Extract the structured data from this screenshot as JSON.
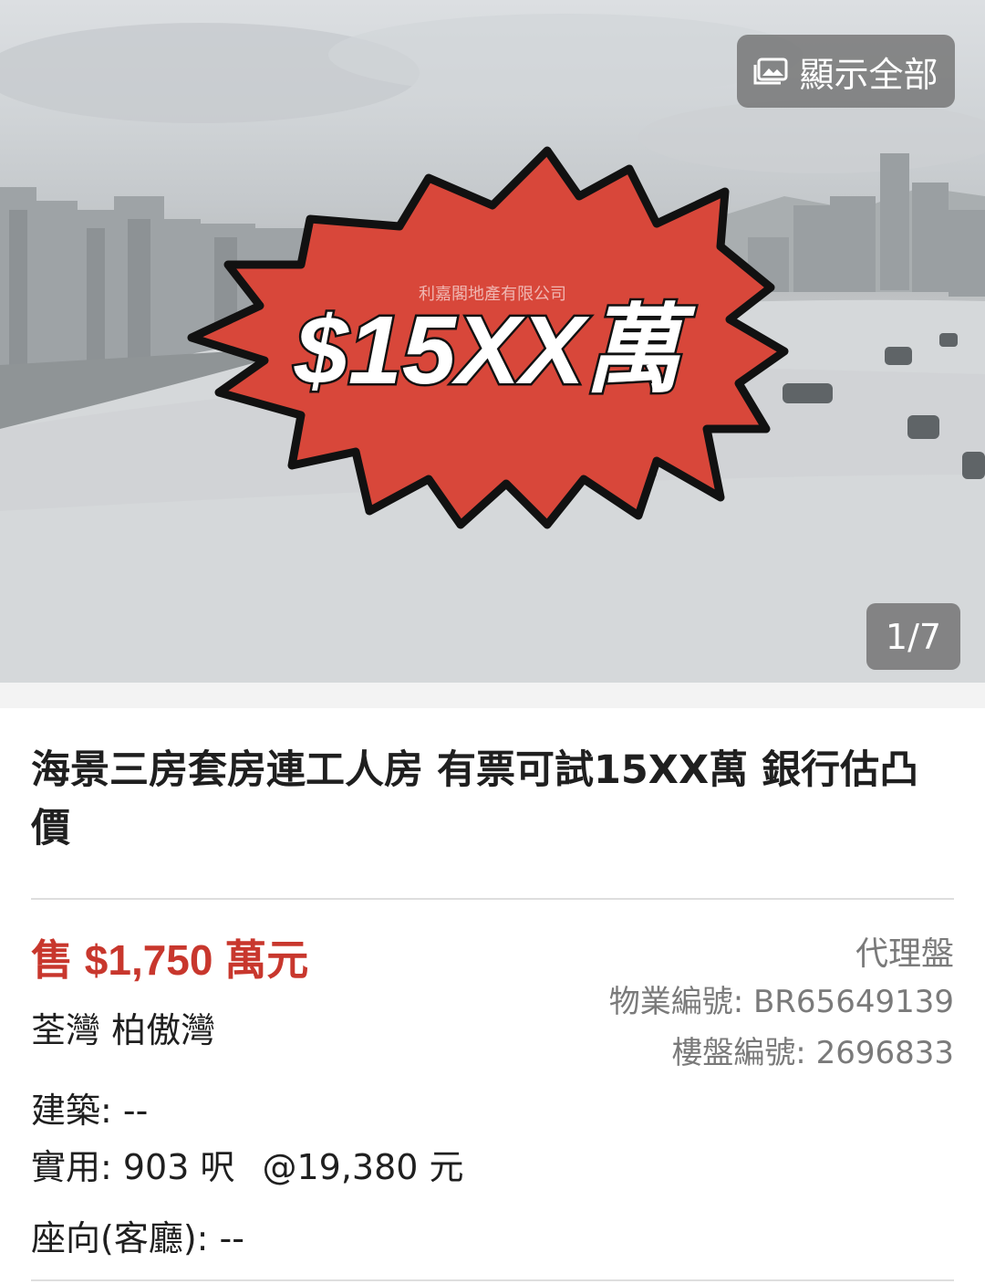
{
  "gallery": {
    "show_all_label": "顯示全部",
    "counter": "1/7",
    "banner_text": "$15XX萬",
    "watermark": "利嘉閣地產有限公司",
    "banner_color": "#d8473a"
  },
  "listing": {
    "title": "海景三房套房連工人房 有票可試15XX萬 銀行估凸價",
    "price": "售 $1,750 萬元",
    "location": "荃灣 柏傲灣",
    "agency_tag": "代理盤",
    "property_no": "物業編號: BR65649139",
    "listing_no": "樓盤編號: 2696833",
    "gross_area": "建築: --",
    "saleable_area": "實用: 903 呎",
    "unit_price": "@19,380 元",
    "orientation": "座向(客廳): --"
  },
  "colors": {
    "price": "#c8372d",
    "secondary_text": "#7a7a7a"
  }
}
